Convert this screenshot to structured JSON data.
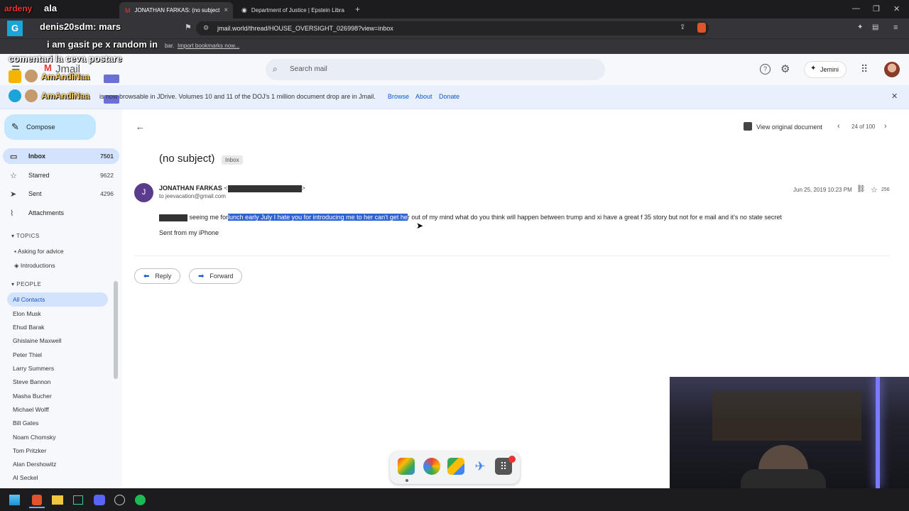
{
  "browser": {
    "tabs": [
      {
        "title": "JONATHAN FARKAS: (no subject"
      },
      {
        "title": "Department of Justice | Epstein Libra"
      }
    ],
    "url": "jmail.world/thread/HOUSE_OVERSIGHT_026998?view=inbox",
    "bookmark_hint": "bar.",
    "import_bookmarks": "Import bookmarks now..."
  },
  "overlay": {
    "stream_title": "ala",
    "user_line": "denis20sdm: mars",
    "chat_line1": "i am gasit pe x random in",
    "chat_line2": "comentari la ceva postare",
    "name1": "AmAndiNaa",
    "name2": "AmAndiNaa"
  },
  "app": {
    "logo": "Jmail",
    "search_placeholder": "Search mail",
    "jemini_label": "Jemini"
  },
  "banner": {
    "text": "is now browsable in JDrive. Volumes 10 and 11 of the DOJ's 1 million document drop are in Jmail.",
    "browse": "Browse",
    "about": "About",
    "donate": "Donate"
  },
  "sidebar": {
    "compose": "Compose",
    "nav": [
      {
        "label": "Inbox",
        "count": "7501"
      },
      {
        "label": "Starred",
        "count": "9622"
      },
      {
        "label": "Sent",
        "count": "4296"
      },
      {
        "label": "Attachments",
        "count": ""
      }
    ],
    "topics_header": "TOPICS",
    "topics": [
      "Asking for advice",
      "Introductions"
    ],
    "people_header": "PEOPLE",
    "people": [
      "All Contacts",
      "Elon Musk",
      "Ehud Barak",
      "Ghislaine Maxwell",
      "Peter Thiel",
      "Larry Summers",
      "Steve Bannon",
      "Masha Bucher",
      "Michael Wolff",
      "Bill Gates",
      "Noam Chomsky",
      "Tom Pritzker",
      "Alan Dershowitz",
      "Al Seckel"
    ]
  },
  "email": {
    "view_original": "View original document",
    "pager": "24 of 100",
    "subject": "(no subject)",
    "label": "Inbox",
    "avatar_letter": "J",
    "sender": "JONATHAN FARKAS",
    "to": "to jeevacation@gmail.com",
    "date": "Jun 25, 2019 10:23 PM",
    "star_count": "256",
    "body_pre": "seeing me for",
    "body_selected": "lunch early July I hate you for introducing me to her can't get he",
    "body_post": "r out of my mind what do you think will happen between trump and xi have a great f 35 story but not for e mail and it's no state secret",
    "signature": "Sent from my iPhone",
    "reply": "Reply",
    "forward": "Forward"
  },
  "colors": {
    "selection": "#2d63d6",
    "accent": "#0b57d0",
    "compose_bg": "#c2e7ff"
  }
}
